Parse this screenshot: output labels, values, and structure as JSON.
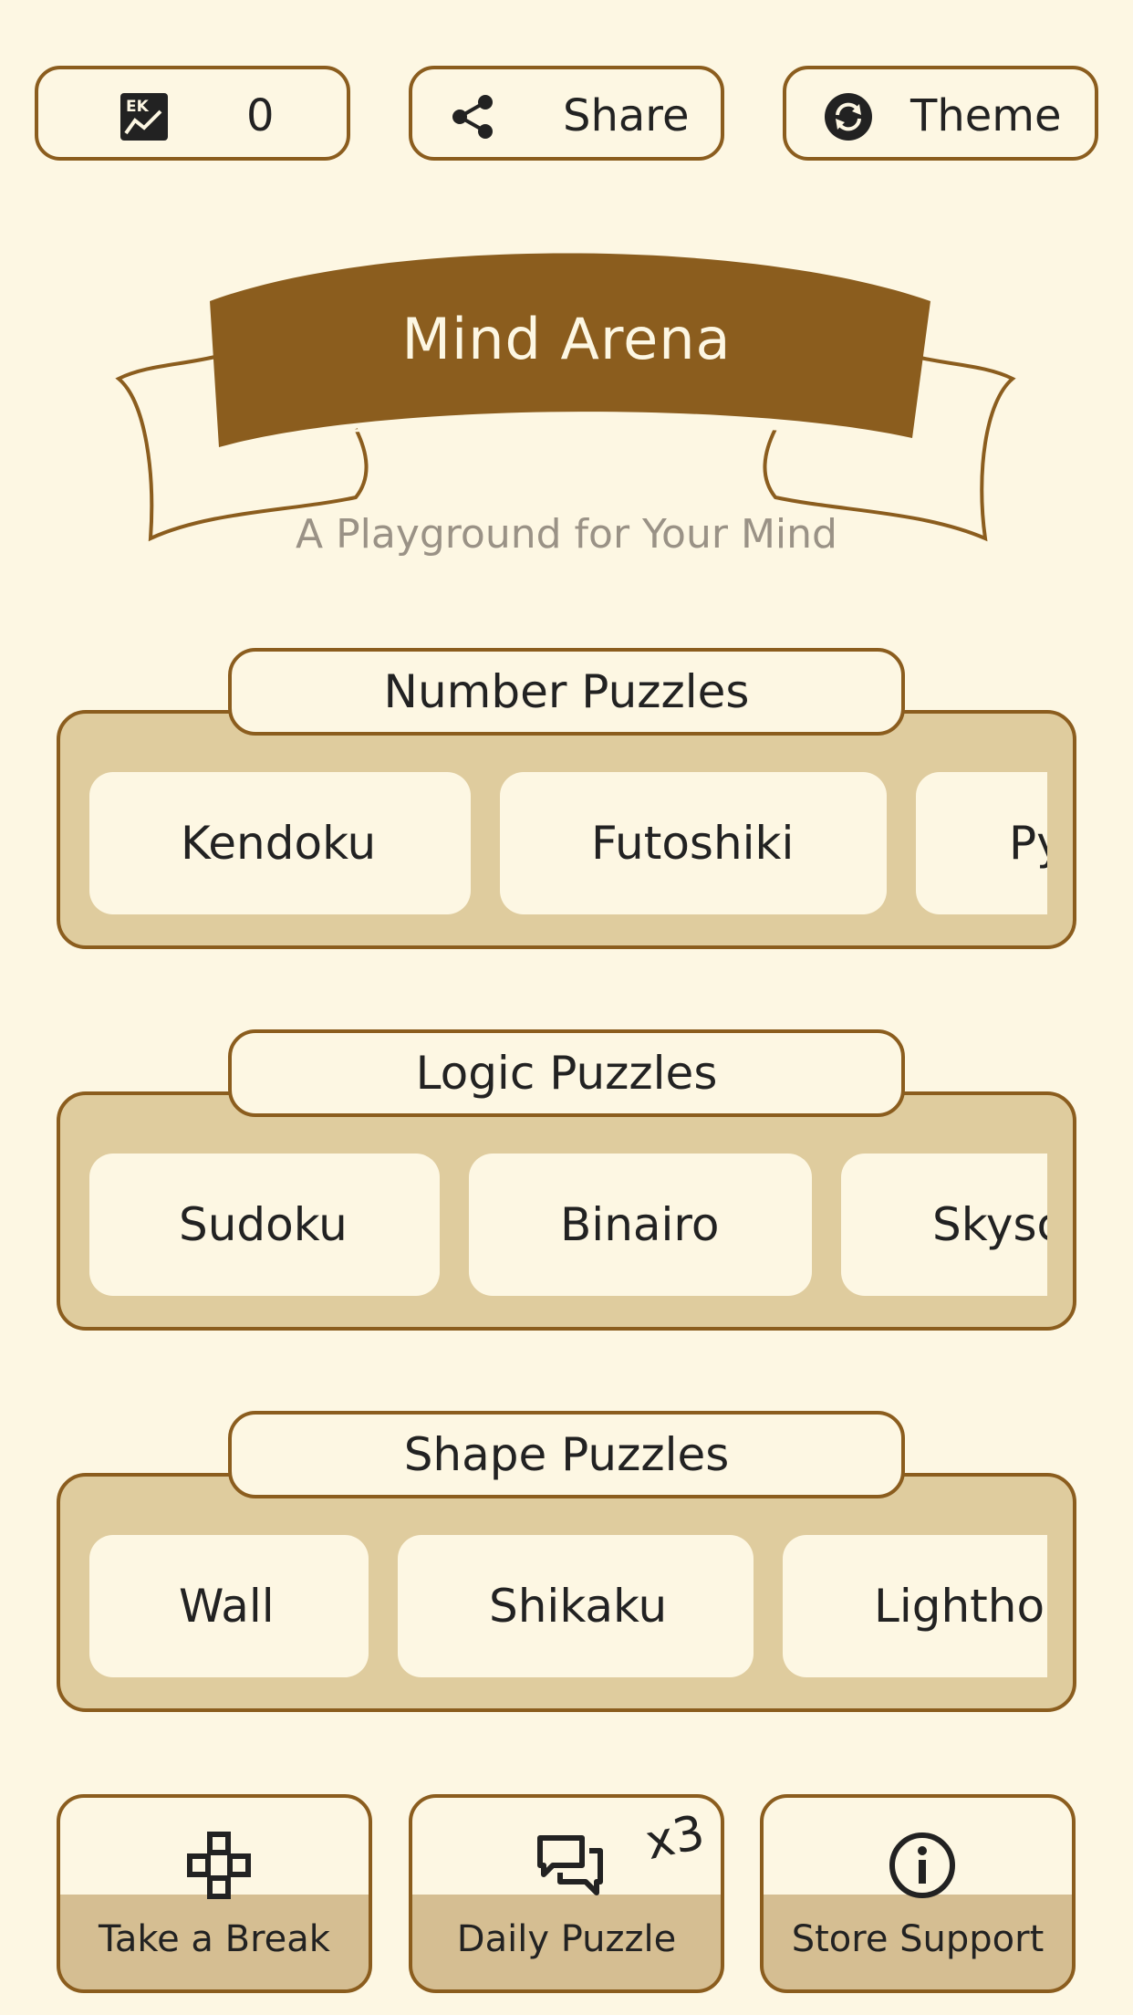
{
  "top_bar": {
    "stats": {
      "icon": "stats-chart-icon",
      "value": "0"
    },
    "share": {
      "icon": "share-icon",
      "label": "Share"
    },
    "theme": {
      "icon": "theme-sync-icon",
      "label": "Theme"
    }
  },
  "header": {
    "title": "Mind Arena",
    "subtitle": "A Playground for Your Mind",
    "banner_color": "#8b5d1e"
  },
  "sections": [
    {
      "title": "Number Puzzles",
      "items": [
        "Kendoku",
        "Futoshiki",
        "Py"
      ]
    },
    {
      "title": "Logic Puzzles",
      "items": [
        "Sudoku",
        "Binairo",
        "Skysc"
      ]
    },
    {
      "title": "Shape Puzzles",
      "items": [
        "Wall",
        "Shikaku",
        "Lighthou"
      ]
    }
  ],
  "bottom_bar": {
    "break": {
      "icon": "gamepad-icon",
      "label": "Take a Break"
    },
    "daily": {
      "icon": "chat-bubbles-icon",
      "label": "Daily Puzzle",
      "badge": "x3"
    },
    "support": {
      "icon": "info-icon",
      "label": "Store Support"
    }
  },
  "colors": {
    "background": "#fdf7e3",
    "accent": "#8b5d1e",
    "panel": "#dfcc9e",
    "button_footer": "#d5be92"
  }
}
